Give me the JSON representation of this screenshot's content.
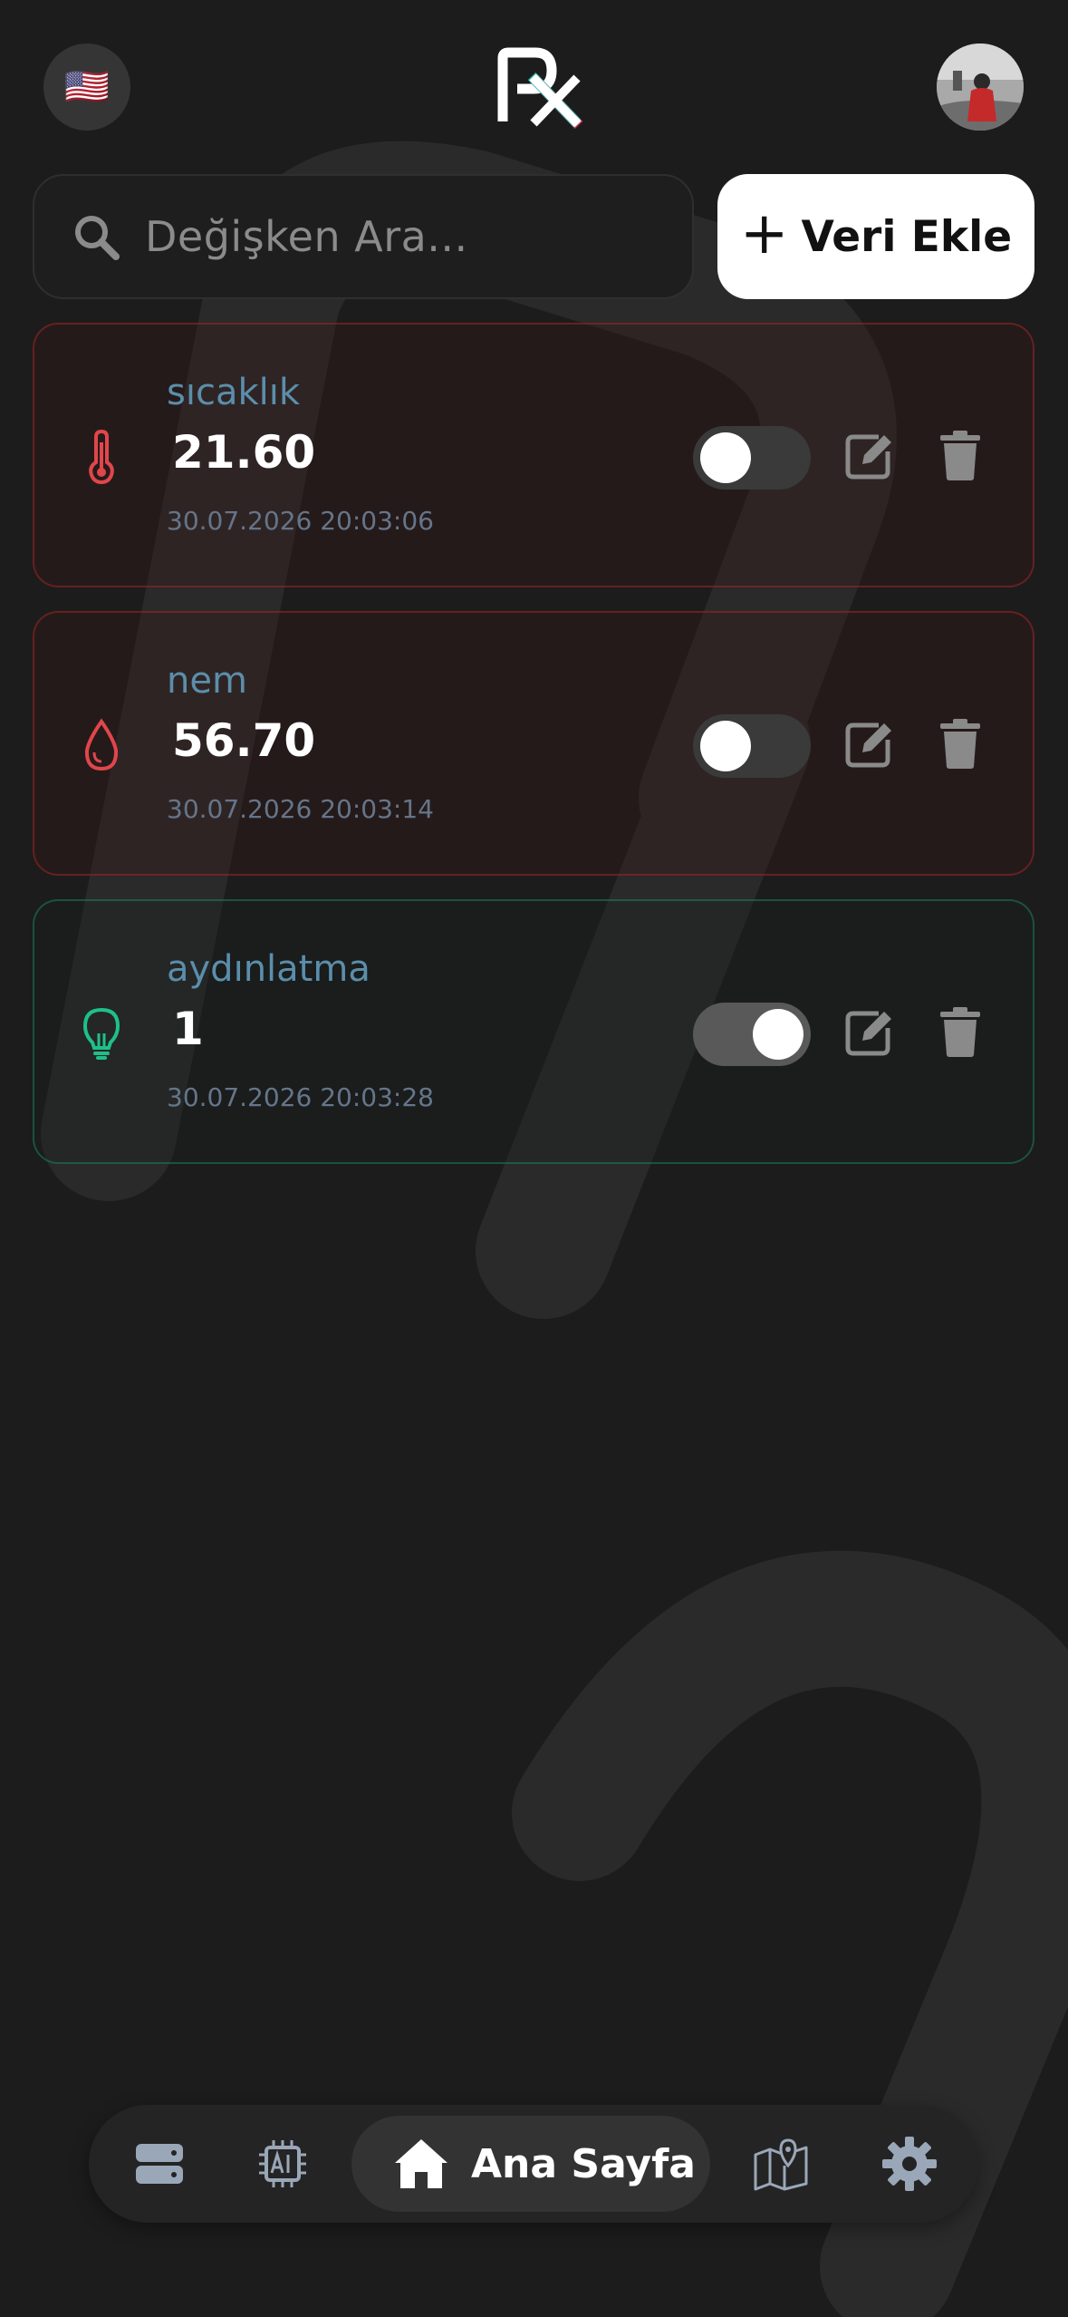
{
  "header": {
    "language_flag": "🇺🇸",
    "logo_text": "PX"
  },
  "search": {
    "placeholder": "Değişken Ara..."
  },
  "add_button": {
    "plus": "+",
    "label": "Veri Ekle"
  },
  "variables": [
    {
      "name": "sıcaklık",
      "value": "21.60",
      "timestamp": "30.07.2026 20:03:06",
      "icon": "thermometer-icon",
      "toggle_on": false,
      "status_color": "#e0464b"
    },
    {
      "name": "nem",
      "value": "56.70",
      "timestamp": "30.07.2026 20:03:14",
      "icon": "water-drop-icon",
      "toggle_on": false,
      "status_color": "#e0464b"
    },
    {
      "name": "aydınlatma",
      "value": "1",
      "timestamp": "30.07.2026 20:03:28",
      "icon": "lightbulb-icon",
      "toggle_on": true,
      "status_color": "#1ec08a"
    }
  ],
  "bottom_nav": {
    "items": [
      {
        "icon": "server-icon"
      },
      {
        "icon": "ai-chip-icon"
      },
      {
        "icon": "home-icon",
        "label": "Ana Sayfa",
        "active": true
      },
      {
        "icon": "map-icon"
      },
      {
        "icon": "gear-icon"
      }
    ]
  },
  "colors": {
    "background": "#1c1c1c",
    "accent_label": "#5b8eab",
    "alert_red": "#e0464b",
    "ok_green": "#1ec08a"
  }
}
